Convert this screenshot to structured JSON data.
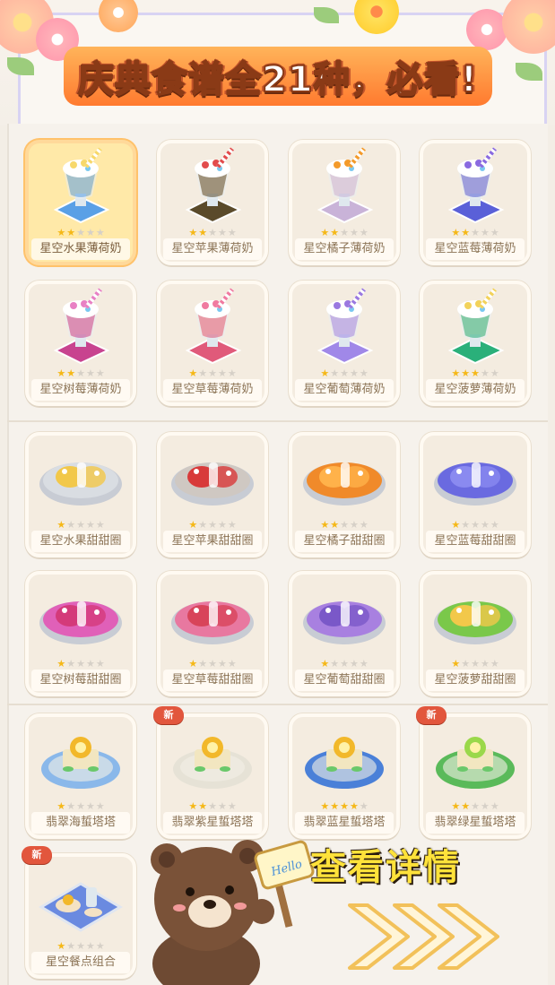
{
  "header": {
    "title": "庆典食谱全21种，必看!"
  },
  "recipes": [
    {
      "name": "星空水果薄荷奶",
      "stars": 2,
      "selected": true,
      "new": false,
      "kind": "milk",
      "color": "#5aa0e6",
      "top": "#f7d86a"
    },
    {
      "name": "星空苹果薄荷奶",
      "stars": 2,
      "selected": false,
      "new": false,
      "kind": "milk",
      "color": "#5a4a2a",
      "top": "#e24c4c"
    },
    {
      "name": "星空橘子薄荷奶",
      "stars": 2,
      "selected": false,
      "new": false,
      "kind": "milk",
      "color": "#c9b3d8",
      "top": "#f39a2a"
    },
    {
      "name": "星空蓝莓薄荷奶",
      "stars": 2,
      "selected": false,
      "new": false,
      "kind": "milk",
      "color": "#5a60d8",
      "top": "#8a6ae0"
    },
    {
      "name": "星空树莓薄荷奶",
      "stars": 2,
      "selected": false,
      "new": false,
      "kind": "milk",
      "color": "#c8438f",
      "top": "#e880c4"
    },
    {
      "name": "星空草莓薄荷奶",
      "stars": 1,
      "selected": false,
      "new": false,
      "kind": "milk",
      "color": "#e05a7a",
      "top": "#f07aa0"
    },
    {
      "name": "星空葡萄薄荷奶",
      "stars": 1,
      "selected": false,
      "new": false,
      "kind": "milk",
      "color": "#a088e8",
      "top": "#9a78e0"
    },
    {
      "name": "星空菠萝薄荷奶",
      "stars": 3,
      "selected": false,
      "new": false,
      "kind": "milk",
      "color": "#2ab07a",
      "top": "#f2d25a"
    },
    {
      "name": "星空水果甜甜圈",
      "stars": 1,
      "selected": false,
      "new": false,
      "kind": "donut",
      "color": "#d9dde2",
      "top": "#f2c84a"
    },
    {
      "name": "星空苹果甜甜圈",
      "stars": 1,
      "selected": false,
      "new": false,
      "kind": "donut",
      "color": "#cfc8c2",
      "top": "#d83a3a"
    },
    {
      "name": "星空橘子甜甜圈",
      "stars": 2,
      "selected": false,
      "new": false,
      "kind": "donut",
      "color": "#f08a2a",
      "top": "#ffb24a"
    },
    {
      "name": "星空蓝莓甜甜圈",
      "stars": 1,
      "selected": false,
      "new": false,
      "kind": "donut",
      "color": "#6a6ae0",
      "top": "#8a8af0"
    },
    {
      "name": "星空树莓甜甜圈",
      "stars": 1,
      "selected": false,
      "new": false,
      "kind": "donut",
      "color": "#e060b8",
      "top": "#d43a7a"
    },
    {
      "name": "星空草莓甜甜圈",
      "stars": 1,
      "selected": false,
      "new": false,
      "kind": "donut",
      "color": "#e878a0",
      "top": "#d8445a"
    },
    {
      "name": "星空葡萄甜甜圈",
      "stars": 1,
      "selected": false,
      "new": false,
      "kind": "donut",
      "color": "#a880e0",
      "top": "#7a58c8"
    },
    {
      "name": "星空菠萝甜甜圈",
      "stars": 1,
      "selected": false,
      "new": false,
      "kind": "donut",
      "color": "#7ac84a",
      "top": "#f2c84a"
    },
    {
      "name": "翡翠海蜇塔塔",
      "stars": 1,
      "selected": false,
      "new": false,
      "kind": "tart",
      "color": "#8ab8ea",
      "top": "#f2b82a"
    },
    {
      "name": "翡翠紫星蜇塔塔",
      "stars": 2,
      "selected": false,
      "new": true,
      "kind": "tart",
      "color": "#e6e2d6",
      "top": "#f2b82a"
    },
    {
      "name": "翡翠蓝星蜇塔塔",
      "stars": 4,
      "selected": false,
      "new": false,
      "kind": "tart",
      "color": "#4a80d8",
      "top": "#f2b82a"
    },
    {
      "name": "翡翠绿星蜇塔塔",
      "stars": 2,
      "selected": false,
      "new": true,
      "kind": "tart",
      "color": "#5aba5a",
      "top": "#9ad84a"
    },
    {
      "name": "星空餐点组合",
      "stars": 1,
      "selected": false,
      "new": true,
      "kind": "tray",
      "color": "#6a8ae0",
      "top": "#f2b82a"
    }
  ],
  "new_badge": "新",
  "overlay": {
    "cta": "查看详情",
    "sign": "Hello"
  },
  "colors": {
    "accent": "#ff7a2f",
    "card_bg": "#f4ece0",
    "star_on": "#f5b818",
    "star_off": "#d6d0c7",
    "new_badge": "#e2563d"
  }
}
